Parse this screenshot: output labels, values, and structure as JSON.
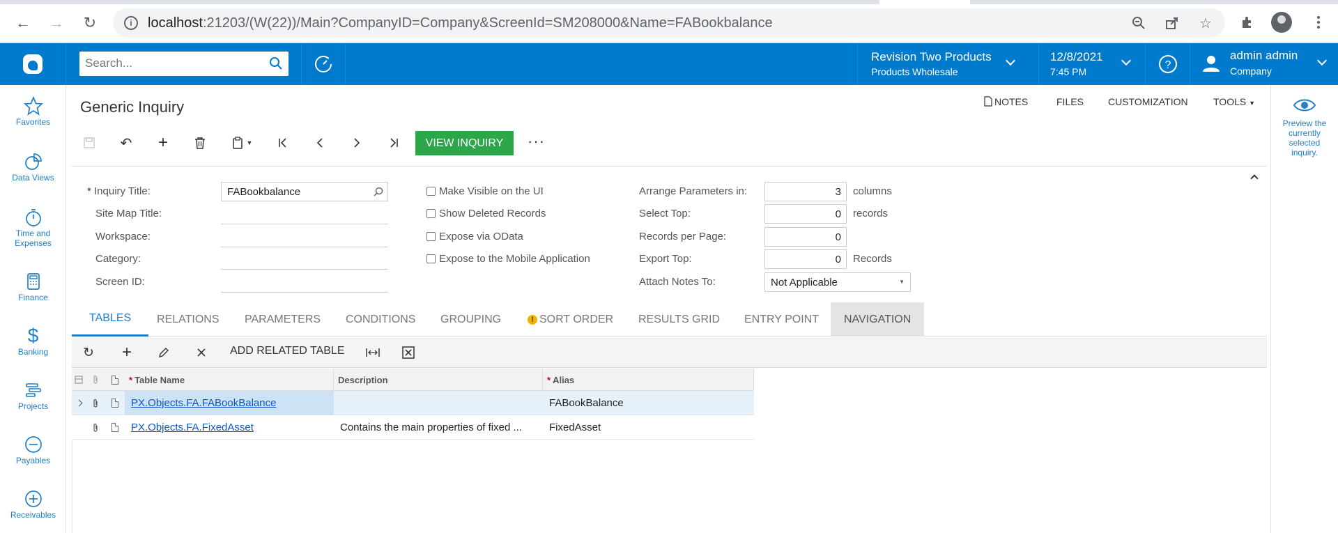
{
  "browser": {
    "url_host": "localhost",
    "url_rest": ":21203/(W(22))/Main?CompanyID=Company&ScreenId=SM208000&Name=FABookbalance"
  },
  "topbar": {
    "search_placeholder": "Search...",
    "company_title": "Revision Two Products",
    "company_sub": "Products Wholesale",
    "date": "12/8/2021",
    "time": "7:45 PM",
    "user_name": "admin admin",
    "user_company": "Company"
  },
  "leftnav": {
    "items": [
      {
        "label": "Favorites"
      },
      {
        "label": "Data Views"
      },
      {
        "label": "Time and Expenses"
      },
      {
        "label": "Finance"
      },
      {
        "label": "Banking"
      },
      {
        "label": "Projects"
      },
      {
        "label": "Payables"
      },
      {
        "label": "Receivables"
      }
    ]
  },
  "rightpanel": {
    "text": "Preview the currently selected inquiry."
  },
  "page": {
    "title": "Generic Inquiry",
    "links": {
      "notes": "NOTES",
      "files": "FILES",
      "customization": "CUSTOMIZATION",
      "tools": "TOOLS"
    },
    "view_inquiry": "VIEW INQUIRY",
    "more": "···"
  },
  "form": {
    "inquiry_title_label": "Inquiry Title:",
    "inquiry_title_value": "FABookbalance",
    "site_map_title_label": "Site Map Title:",
    "workspace_label": "Workspace:",
    "category_label": "Category:",
    "screen_id_label": "Screen ID:",
    "checkboxes": {
      "visible": "Make Visible on the UI",
      "deleted": "Show Deleted Records",
      "odata": "Expose via OData",
      "mobile": "Expose to the Mobile Application"
    },
    "arrange_label": "Arrange Parameters in:",
    "arrange_value": "3",
    "arrange_unit": "columns",
    "select_top_label": "Select Top:",
    "select_top_value": "0",
    "select_top_unit": "records",
    "records_page_label": "Records per Page:",
    "records_page_value": "0",
    "export_top_label": "Export Top:",
    "export_top_value": "0",
    "export_top_unit": "Records",
    "attach_label": "Attach Notes To:",
    "attach_value": "Not Applicable"
  },
  "tabs": [
    {
      "label": "TABLES"
    },
    {
      "label": "RELATIONS"
    },
    {
      "label": "PARAMETERS"
    },
    {
      "label": "CONDITIONS"
    },
    {
      "label": "GROUPING"
    },
    {
      "label": "SORT ORDER"
    },
    {
      "label": "RESULTS GRID"
    },
    {
      "label": "ENTRY POINT"
    },
    {
      "label": "NAVIGATION"
    }
  ],
  "grid_toolbar": {
    "add_related": "ADD RELATED TABLE"
  },
  "grid": {
    "headers": {
      "table_name": "Table Name",
      "description": "Description",
      "alias": "Alias"
    },
    "rows": [
      {
        "table_name": "PX.Objects.FA.FABookBalance",
        "description": "",
        "alias": "FABookBalance"
      },
      {
        "table_name": "PX.Objects.FA.FixedAsset",
        "description": "Contains the main properties of fixed ...",
        "alias": "FixedAsset"
      }
    ]
  },
  "colors": {
    "brand": "#007acc",
    "primary_button": "#2ba74a",
    "link": "#0b57c7",
    "nav_text": "#1f7fc9"
  }
}
